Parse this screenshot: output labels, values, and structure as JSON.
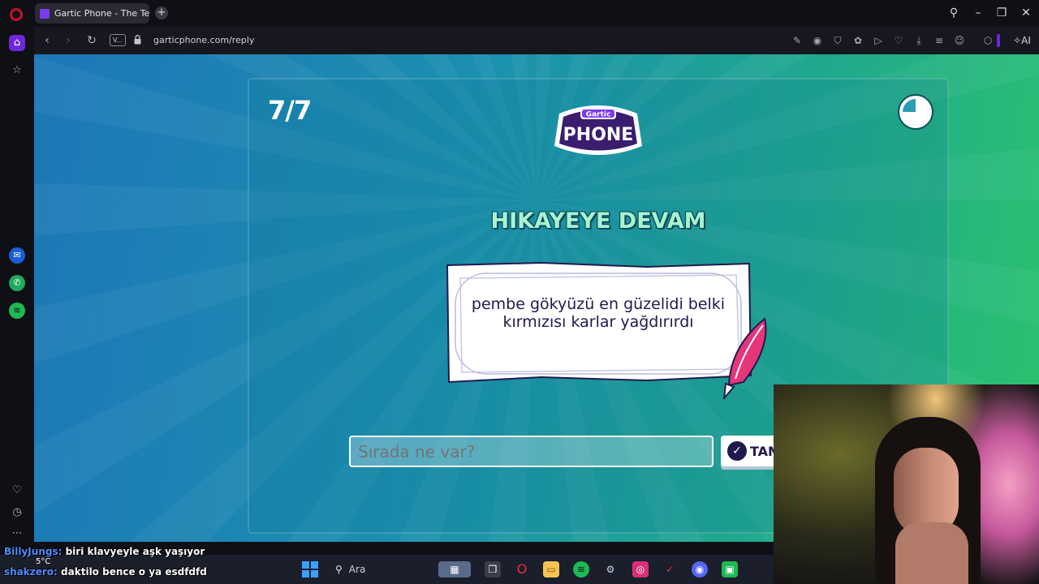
{
  "browser": {
    "tab_title": "Gartic Phone - The Teleph",
    "url": "garticphone.com/reply",
    "vpn_label": "V...",
    "ai_label": "AI"
  },
  "game": {
    "round_counter": "7/7",
    "logo_top": "Gartic",
    "logo_main": "PHONE",
    "heading": "HIKAYEYE DEVAM",
    "story_text": "pembe gökyüzü en güzelidi belki kırmızısı karlar yağdırırdı",
    "input_placeholder": "Sırada ne var?",
    "done_label": "TAM",
    "timer_fraction": 0.75
  },
  "chat": {
    "lines": [
      {
        "user": "BillyJungs:",
        "message": "biri klavyeyle aşk yaşıyor"
      },
      {
        "user": "shakzero:",
        "message": "daktilo bence o ya esdfdfd"
      }
    ]
  },
  "taskbar": {
    "temperature": "5°C",
    "search_label": "Ara"
  },
  "colors": {
    "accent_purple": "#6d28d9",
    "heading_mint": "#a7f3d0",
    "ink_navy": "#1f1a4d"
  }
}
